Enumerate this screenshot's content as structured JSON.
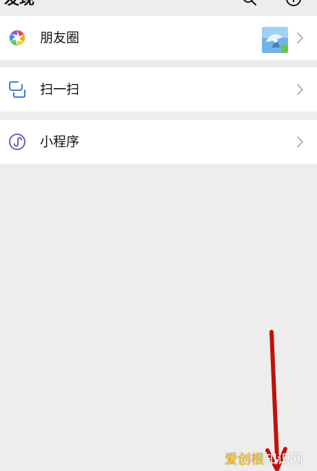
{
  "header": {
    "title": "发现",
    "search_icon": "search-icon",
    "add_icon": "add-circle-icon"
  },
  "menu": [
    {
      "label": "朋友圈",
      "icon": "moments-aperture-icon",
      "has_thumbnail": true
    },
    {
      "label": "扫一扫",
      "icon": "scan-icon",
      "has_thumbnail": false
    },
    {
      "label": "小程序",
      "icon": "mini-program-icon",
      "has_thumbnail": false
    }
  ],
  "colors": {
    "background": "#ededed",
    "cell": "#ffffff",
    "scan_blue": "#3a7bd5",
    "mini_program_purple": "#6b5fb5",
    "arrow_red": "#c0100c",
    "watermark_orange": "#f6b400"
  },
  "watermark": {
    "part_a": "爱创根",
    "part_b": "知识网"
  }
}
